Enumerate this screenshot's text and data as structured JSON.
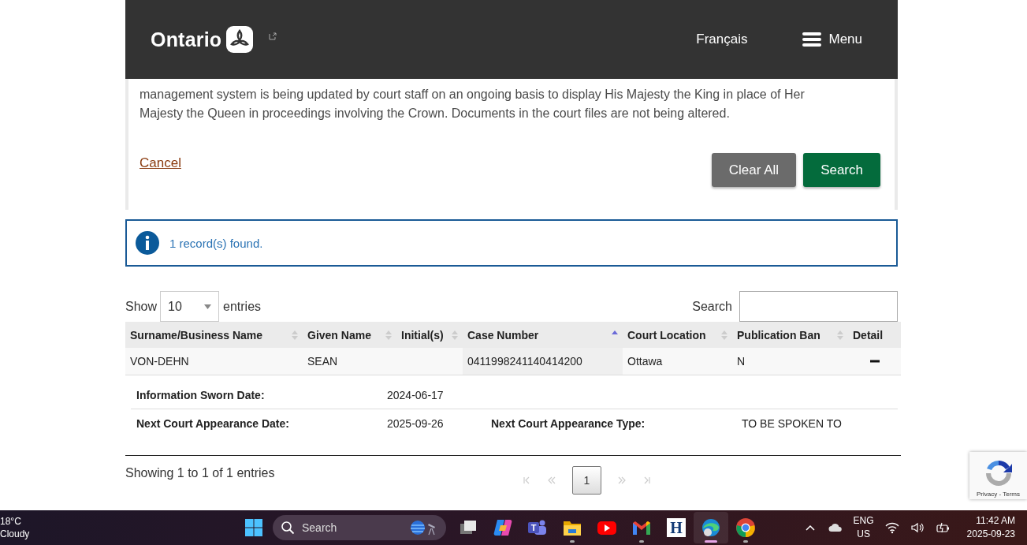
{
  "header": {
    "logo": "Ontario",
    "language_link": "Français",
    "menu": "Menu"
  },
  "notice": {
    "text": "management system is being updated by court staff on an ongoing basis to display His Majesty the King in place of Her Majesty the Queen in proceedings involving the Crown. Documents in the court files are not being altered."
  },
  "form_actions": {
    "cancel": "Cancel",
    "buttons": [
      {
        "label": "Clear All",
        "kind": "secondary"
      },
      {
        "label": "Search",
        "kind": "primary"
      }
    ]
  },
  "alert": {
    "text": "1 record(s) found."
  },
  "table_controls": {
    "show_label": "Show",
    "page_size": "10",
    "entries_label": "entries",
    "search_label": "Search"
  },
  "table": {
    "columns": [
      {
        "label": "Surname/Business Name",
        "sorted": false
      },
      {
        "label": "Given Name",
        "sorted": false
      },
      {
        "label": "Initial(s)",
        "sorted": false
      },
      {
        "label": "Case Number",
        "sorted": true
      },
      {
        "label": "Court Location",
        "sorted": false
      },
      {
        "label": "Publication Ban",
        "sorted": false
      },
      {
        "label": "Detail"
      }
    ],
    "rows": [
      {
        "cells": [
          "VON-DEHN",
          "SEAN",
          "",
          "0411998241140414200",
          "Ottawa",
          "N"
        ],
        "expanded": true,
        "details": [
          [
            {
              "label": "Information Sworn Date:",
              "value": "2024-06-17"
            }
          ],
          [
            {
              "label": "Next Court Appearance Date:",
              "value": "2025-09-26"
            },
            {
              "label": "Next Court Appearance Type:",
              "value": "TO BE SPOKEN TO"
            }
          ]
        ]
      }
    ]
  },
  "footer": {
    "info": "Showing 1 to 1 of 1 entries",
    "pages": [
      {
        "label": "1",
        "selected": true
      }
    ]
  },
  "recaptcha": {
    "text": "Privacy - Terms"
  },
  "taskbar": {
    "weather": {
      "temp": "18°C",
      "condition": "Cloudy"
    },
    "search": "Search",
    "apps": [
      {
        "kind": "taskview",
        "running": false,
        "selected": false
      },
      {
        "kind": "copilot",
        "running": false,
        "selected": false
      },
      {
        "kind": "teams",
        "running": false,
        "selected": false,
        "label": "T"
      },
      {
        "kind": "folder",
        "running": true,
        "selected": false
      },
      {
        "kind": "youtube",
        "running": false,
        "selected": false
      },
      {
        "kind": "gmail",
        "running": true,
        "selected": false
      },
      {
        "kind": "letter",
        "running": false,
        "selected": false,
        "label": "H"
      },
      {
        "kind": "edge",
        "running": true,
        "selected": true
      },
      {
        "kind": "chrome",
        "running": true,
        "selected": false
      }
    ],
    "language": "ENG",
    "region": "US",
    "time": "11:42 AM",
    "date": "2025-09-23"
  }
}
